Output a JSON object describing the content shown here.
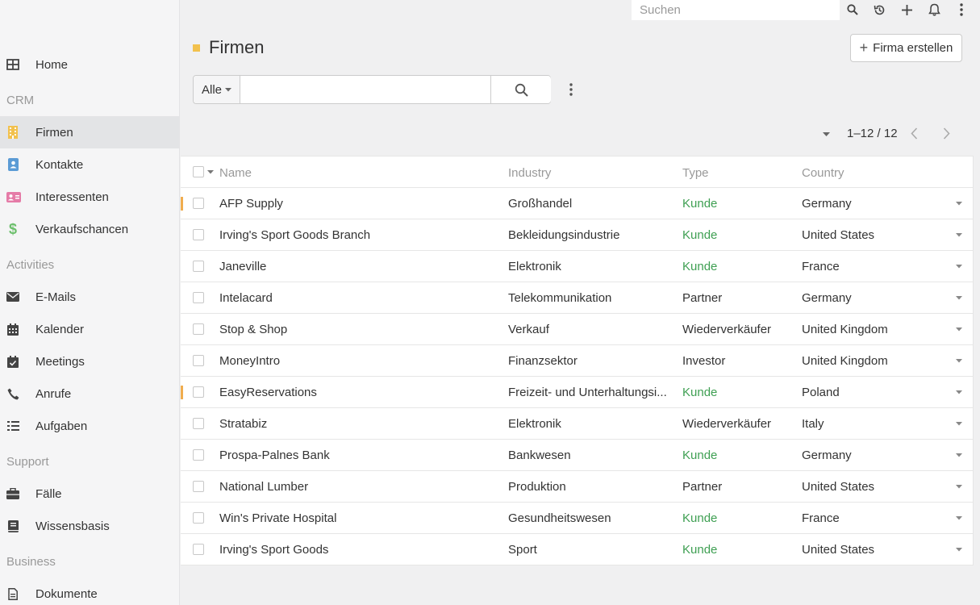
{
  "topbar": {
    "search_placeholder": "Suchen",
    "icons": [
      "search-icon",
      "history-icon",
      "plus-icon",
      "bell-icon",
      "kebab-icon"
    ]
  },
  "sidebar": {
    "items": [
      {
        "label": "Home",
        "icon": "grid-icon"
      },
      {
        "group": "CRM"
      },
      {
        "label": "Firmen",
        "icon": "building-icon",
        "active": true,
        "color": "#f2c14e"
      },
      {
        "label": "Kontakte",
        "icon": "contact-icon",
        "color": "#5b9bd5"
      },
      {
        "label": "Interessenten",
        "icon": "id-card-icon",
        "color": "#e57ba7"
      },
      {
        "label": "Verkaufschancen",
        "icon": "dollar-icon",
        "color": "#6cbf6c"
      },
      {
        "group": "Activities"
      },
      {
        "label": "E-Mails",
        "icon": "envelope-icon"
      },
      {
        "label": "Kalender",
        "icon": "calendar-icon"
      },
      {
        "label": "Meetings",
        "icon": "calendar-check-icon"
      },
      {
        "label": "Anrufe",
        "icon": "phone-icon"
      },
      {
        "label": "Aufgaben",
        "icon": "tasks-icon"
      },
      {
        "group": "Support"
      },
      {
        "label": "Fälle",
        "icon": "briefcase-icon"
      },
      {
        "label": "Wissensbasis",
        "icon": "book-icon"
      },
      {
        "group": "Business"
      },
      {
        "label": "Dokumente",
        "icon": "document-icon"
      }
    ]
  },
  "header": {
    "title": "Firmen",
    "create_label": "Firma erstellen"
  },
  "filter": {
    "select_value": "Alle",
    "input_value": ""
  },
  "pagination": {
    "text": "1–12 / 12"
  },
  "table": {
    "columns": [
      "Name",
      "Industry",
      "Type",
      "Country"
    ],
    "rows": [
      {
        "name": "AFP Supply",
        "industry": "Großhandel",
        "type": "Kunde",
        "country": "Germany",
        "marked": true
      },
      {
        "name": "Irving's Sport Goods Branch",
        "industry": "Bekleidungsindustrie",
        "type": "Kunde",
        "country": "United States"
      },
      {
        "name": "Janeville",
        "industry": "Elektronik",
        "type": "Kunde",
        "country": "France"
      },
      {
        "name": "Intelacard",
        "industry": "Telekommunikation",
        "type": "Partner",
        "country": "Germany"
      },
      {
        "name": "Stop & Shop",
        "industry": "Verkauf",
        "type": "Wiederverkäufer",
        "country": "United Kingdom"
      },
      {
        "name": "MoneyIntro",
        "industry": "Finanzsektor",
        "type": "Investor",
        "country": "United Kingdom"
      },
      {
        "name": "EasyReservations",
        "industry": "Freizeit- und Unterhaltungsi...",
        "type": "Kunde",
        "country": "Poland",
        "marked": true
      },
      {
        "name": "Stratabiz",
        "industry": "Elektronik",
        "type": "Wiederverkäufer",
        "country": "Italy"
      },
      {
        "name": "Prospa-Palnes Bank",
        "industry": "Bankwesen",
        "type": "Kunde",
        "country": "Germany"
      },
      {
        "name": "National Lumber",
        "industry": "Produktion",
        "type": "Partner",
        "country": "United States"
      },
      {
        "name": "Win's Private Hospital",
        "industry": "Gesundheitswesen",
        "type": "Kunde",
        "country": "France"
      },
      {
        "name": "Irving's Sport Goods",
        "industry": "Sport",
        "type": "Kunde",
        "country": "United States"
      }
    ]
  },
  "colors": {
    "accent": "#f2c14e",
    "kunde_green": "#3e9f52",
    "row_marker": "#f0ad4e"
  }
}
